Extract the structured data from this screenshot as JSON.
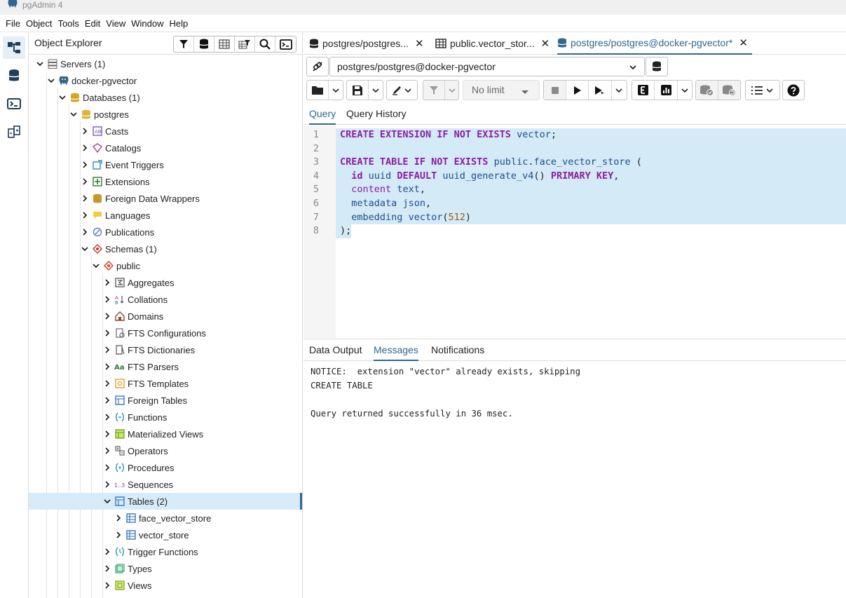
{
  "window": {
    "title": "pgAdmin 4"
  },
  "menu": [
    "File",
    "Object",
    "Tools",
    "Edit",
    "View",
    "Window",
    "Help"
  ],
  "explorer": {
    "title": "Object Explorer",
    "tools": [
      "filter-icon",
      "database-icon",
      "table-view-icon",
      "filter-table-icon",
      "search-icon",
      "terminal-icon"
    ],
    "tree": [
      {
        "label": "Servers (1)",
        "icon": "servers-icon",
        "level": 0,
        "expanded": true
      },
      {
        "label": "docker-pgvector",
        "icon": "elephant-icon",
        "level": 1,
        "expanded": true
      },
      {
        "label": "Databases (1)",
        "icon": "databases-icon",
        "level": 2,
        "expanded": true
      },
      {
        "label": "postgres",
        "icon": "database-icon",
        "level": 3,
        "expanded": true
      },
      {
        "label": "Casts",
        "icon": "casts-icon",
        "level": 4,
        "expanded": false
      },
      {
        "label": "Catalogs",
        "icon": "catalogs-icon",
        "level": 4,
        "expanded": false
      },
      {
        "label": "Event Triggers",
        "icon": "event-triggers-icon",
        "level": 4,
        "expanded": false
      },
      {
        "label": "Extensions",
        "icon": "extensions-icon",
        "level": 4,
        "expanded": false
      },
      {
        "label": "Foreign Data Wrappers",
        "icon": "fdw-icon",
        "level": 4,
        "expanded": false
      },
      {
        "label": "Languages",
        "icon": "languages-icon",
        "level": 4,
        "expanded": false
      },
      {
        "label": "Publications",
        "icon": "publications-icon",
        "level": 4,
        "expanded": false
      },
      {
        "label": "Schemas (1)",
        "icon": "schemas-icon",
        "level": 4,
        "expanded": true
      },
      {
        "label": "public",
        "icon": "schema-icon",
        "level": 5,
        "expanded": true
      },
      {
        "label": "Aggregates",
        "icon": "aggregates-icon",
        "level": 6,
        "expanded": false
      },
      {
        "label": "Collations",
        "icon": "collations-icon",
        "level": 6,
        "expanded": false
      },
      {
        "label": "Domains",
        "icon": "domains-icon",
        "level": 6,
        "expanded": false
      },
      {
        "label": "FTS Configurations",
        "icon": "fts-config-icon",
        "level": 6,
        "expanded": false
      },
      {
        "label": "FTS Dictionaries",
        "icon": "fts-dict-icon",
        "level": 6,
        "expanded": false
      },
      {
        "label": "FTS Parsers",
        "icon": "fts-parsers-icon",
        "level": 6,
        "expanded": false
      },
      {
        "label": "FTS Templates",
        "icon": "fts-templates-icon",
        "level": 6,
        "expanded": false
      },
      {
        "label": "Foreign Tables",
        "icon": "foreign-tables-icon",
        "level": 6,
        "expanded": false
      },
      {
        "label": "Functions",
        "icon": "functions-icon",
        "level": 6,
        "expanded": false
      },
      {
        "label": "Materialized Views",
        "icon": "mviews-icon",
        "level": 6,
        "expanded": false
      },
      {
        "label": "Operators",
        "icon": "operators-icon",
        "level": 6,
        "expanded": false
      },
      {
        "label": "Procedures",
        "icon": "procedures-icon",
        "level": 6,
        "expanded": false
      },
      {
        "label": "Sequences",
        "icon": "sequences-icon",
        "level": 6,
        "expanded": false
      },
      {
        "label": "Tables (2)",
        "icon": "tables-icon",
        "level": 6,
        "expanded": true,
        "selected": true
      },
      {
        "label": "face_vector_store",
        "icon": "table-icon",
        "level": 7,
        "expanded": false
      },
      {
        "label": "vector_store",
        "icon": "table-icon",
        "level": 7,
        "expanded": false
      },
      {
        "label": "Trigger Functions",
        "icon": "trigger-functions-icon",
        "level": 6,
        "expanded": false
      },
      {
        "label": "Types",
        "icon": "types-icon",
        "level": 6,
        "expanded": false
      },
      {
        "label": "Views",
        "icon": "views-icon",
        "level": 6,
        "expanded": false
      }
    ]
  },
  "tabs": [
    {
      "label": "postgres/postgres...",
      "icon": "database-icon",
      "active": false
    },
    {
      "label": "public.vector_stor...",
      "icon": "table-icon",
      "active": false
    },
    {
      "label": "postgres/postgres@docker-pgvector*",
      "icon": "database-icon",
      "active": true
    }
  ],
  "connection": {
    "value": "postgres/postgres@docker-pgvector"
  },
  "toolbar": {
    "limit_label": "No limit"
  },
  "query_tabs": [
    "Query",
    "Query History"
  ],
  "code_lines": [
    "CREATE EXTENSION IF NOT EXISTS vector;",
    "",
    "CREATE TABLE IF NOT EXISTS public.face_vector_store (",
    "  id uuid DEFAULT uuid_generate_v4() PRIMARY KEY,",
    "  content text,",
    "  metadata json,",
    "  embedding vector(512)",
    ");"
  ],
  "result_tabs": [
    "Data Output",
    "Messages",
    "Notifications"
  ],
  "messages": [
    "NOTICE:  extension \"vector\" already exists, skipping",
    "CREATE TABLE",
    "",
    "Query returned successfully in 36 msec."
  ],
  "colors": {
    "accent": "#326690",
    "keyword": "#8b1ea3",
    "selection": "#d4eaf7"
  }
}
